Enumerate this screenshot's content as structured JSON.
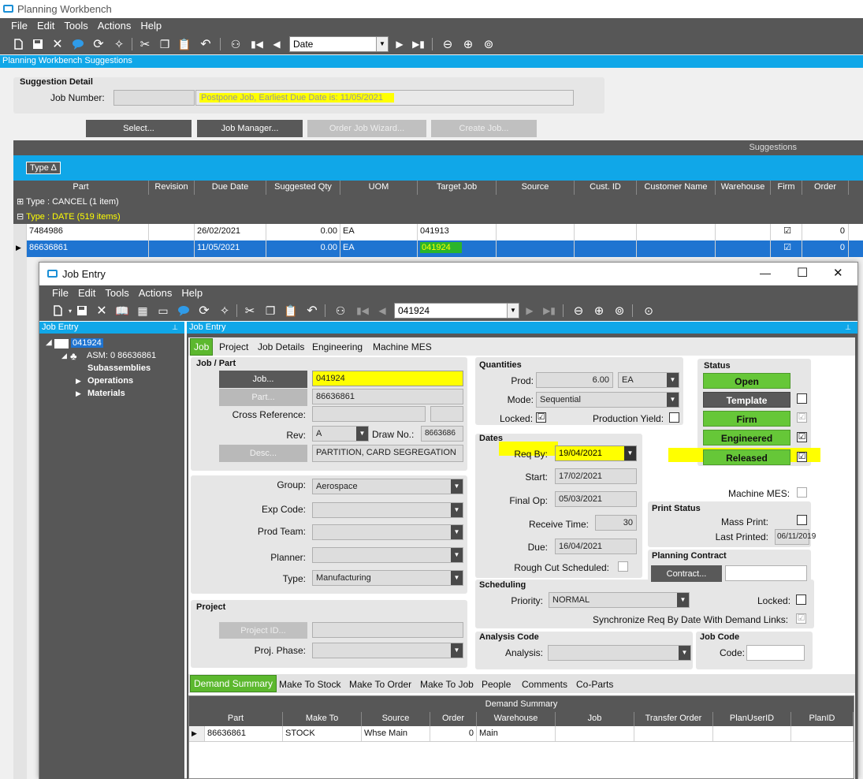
{
  "outer": {
    "title": "Planning Workbench",
    "menu": [
      "File",
      "Edit",
      "Tools",
      "Actions",
      "Help"
    ],
    "nav_combo": "Date",
    "suggestions_bar": "Planning Workbench Suggestions",
    "suggestion_detail": {
      "heading": "Suggestion Detail",
      "job_number_label": "Job Number:",
      "job_number_value": "",
      "message": "Postpone Job, Earliest Due Date is: 11/05/2021"
    },
    "buttons": {
      "select": "Select...",
      "job_manager": "Job Manager...",
      "order_job_wizard": "Order Job Wizard...",
      "create_job": "Create Job..."
    },
    "grid": {
      "title": "Suggestions",
      "group_by": "Type",
      "columns": [
        "Part",
        "Revision",
        "Due Date",
        "Suggested Qty",
        "UOM",
        "Target Job",
        "Source",
        "Cust. ID",
        "Customer Name",
        "Warehouse",
        "Firm",
        "Order"
      ],
      "groups": [
        {
          "label": "Type : CANCEL (1 item)"
        },
        {
          "label": "Type : DATE (519 items)"
        }
      ],
      "rows": [
        {
          "part": "7484986",
          "revision": "",
          "due_date": "26/02/2021",
          "suggested_qty": "0.00",
          "uom": "EA",
          "target_job": "041913",
          "firm": "☑",
          "order": "0"
        },
        {
          "part": "86636861",
          "revision": "",
          "due_date": "11/05/2021",
          "suggested_qty": "0.00",
          "uom": "EA",
          "target_job": "041924",
          "firm": "☑",
          "order": "0"
        }
      ]
    }
  },
  "job_entry": {
    "title": "Job Entry",
    "window_controls": {
      "min": "—",
      "max": "☐",
      "close": "✕"
    },
    "menu": [
      "File",
      "Edit",
      "Tools",
      "Actions",
      "Help"
    ],
    "nav_combo": "041924",
    "tree": {
      "header": "Job Entry",
      "root": "041924",
      "asm": "ASM: 0 86636861",
      "subassemblies": "Subassemblies",
      "operations": "Operations",
      "materials": "Materials"
    },
    "main_header": "Job Entry",
    "tabs": [
      "Job",
      "Project",
      "Job Details",
      "Engineering",
      "Machine MES"
    ],
    "job_part": {
      "heading": "Job / Part",
      "job_btn": "Job...",
      "job_value": "041924",
      "part_btn": "Part...",
      "part_value": "86636861",
      "cross_ref_label": "Cross Reference:",
      "cross_ref_value": "",
      "rev_label": "Rev:",
      "rev_value": "A",
      "drawno_label": "Draw No.:",
      "drawno_value": "8663686",
      "desc_btn": "Desc...",
      "desc_value": "PARTITION, CARD SEGREGATION"
    },
    "attrs": {
      "group_label": "Group:",
      "group_value": "Aerospace",
      "expcode_label": "Exp Code:",
      "expcode_value": "",
      "prodteam_label": "Prod Team:",
      "prodteam_value": "",
      "planner_label": "Planner:",
      "planner_value": "",
      "type_label": "Type:",
      "type_value": "Manufacturing"
    },
    "project": {
      "heading": "Project",
      "project_btn": "Project ID...",
      "project_value": "",
      "phase_label": "Proj. Phase:",
      "phase_value": ""
    },
    "quantities": {
      "heading": "Quantities",
      "prod_label": "Prod:",
      "prod_value": "6.00",
      "uom": "EA",
      "mode_label": "Mode:",
      "mode_value": "Sequential",
      "locked_label": "Locked:",
      "locked": "☑",
      "yield_label": "Production Yield:",
      "yield": ""
    },
    "dates": {
      "heading": "Dates",
      "reqby_label": "Req By:",
      "reqby_value": "19/04/2021",
      "start_label": "Start:",
      "start_value": "17/02/2021",
      "finalop_label": "Final Op:",
      "finalop_value": "05/03/2021",
      "receive_label": "Receive Time:",
      "receive_value": "30",
      "due_label": "Due:",
      "due_value": "16/04/2021",
      "roughcut_label": "Rough Cut Scheduled:",
      "roughcut": ""
    },
    "scheduling": {
      "heading": "Scheduling",
      "priority_label": "Priority:",
      "priority_value": "NORMAL",
      "locked_label": "Locked:",
      "locked": "",
      "sync_label": "Synchronize Req By Date With Demand Links:",
      "sync": "☑"
    },
    "analysis": {
      "heading": "Analysis Code",
      "analysis_label": "Analysis:",
      "analysis_value": ""
    },
    "jobcode": {
      "heading": "Job Code",
      "code_label": "Code:",
      "code_value": ""
    },
    "status": {
      "heading": "Status",
      "open": "Open",
      "template": "Template",
      "template_chk": "",
      "firm": "Firm",
      "firm_chk": "☑",
      "engineered": "Engineered",
      "engineered_chk": "☑",
      "released": "Released",
      "released_chk": "☑",
      "mes_label": "Machine MES:",
      "mes_chk": ""
    },
    "print_status": {
      "heading": "Print Status",
      "mass_label": "Mass Print:",
      "mass_chk": "",
      "last_label": "Last Printed:",
      "last_value": "06/11/2019"
    },
    "planning_contract": {
      "heading": "Planning Contract",
      "btn": "Contract...",
      "value": ""
    },
    "bottom_tabs": [
      "Demand Summary",
      "Make To Stock",
      "Make To Order",
      "Make To Job",
      "People",
      "Comments",
      "Co-Parts"
    ],
    "demand": {
      "title": "Demand Summary",
      "columns": [
        "Part",
        "Make To",
        "Source",
        "Order",
        "Warehouse",
        "Job",
        "Transfer Order",
        "PlanUserID",
        "PlanID"
      ],
      "rows": [
        {
          "part": "86636861",
          "make_to": "STOCK",
          "source": "Whse Main",
          "order": "0",
          "warehouse": "Main",
          "job": "",
          "transfer_order": "",
          "plan_user": "",
          "plan_id": ""
        }
      ]
    }
  },
  "colors": {
    "accent": "#10a7e8",
    "highlight": "#ffff00",
    "status_green": "#66c738",
    "dark_bar": "#575757",
    "selected_row": "#1f74d1"
  }
}
